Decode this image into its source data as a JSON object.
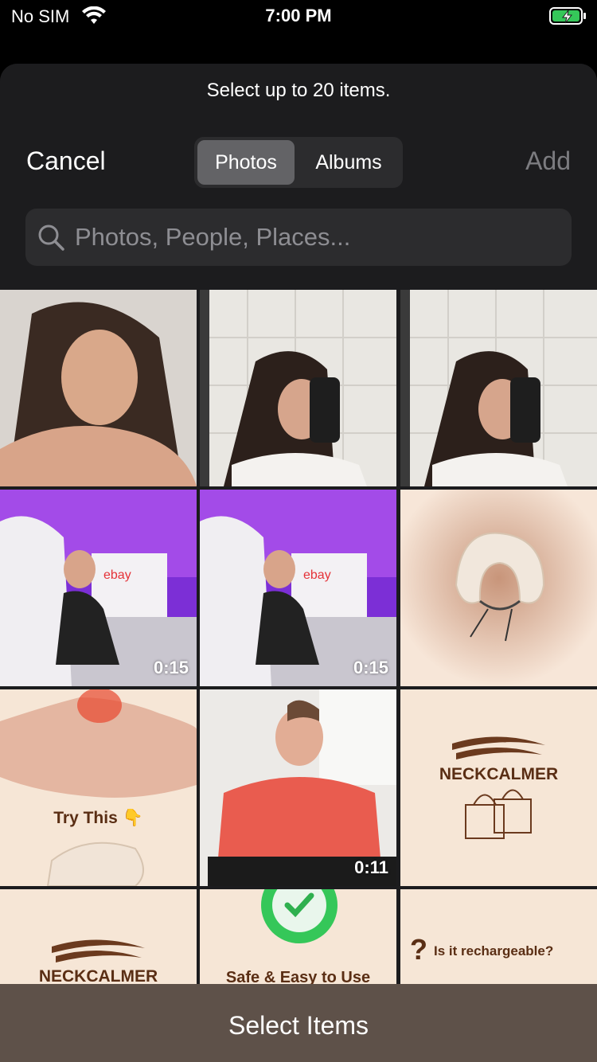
{
  "status_bar": {
    "carrier": "No SIM",
    "time": "7:00 PM",
    "battery_color": "#35c759"
  },
  "header": {
    "hint": "Select up to 20 items.",
    "cancel_label": "Cancel",
    "add_label": "Add",
    "segments": [
      "Photos",
      "Albums"
    ],
    "selected_segment": "Photos"
  },
  "search": {
    "placeholder": "Photos, People, Places..."
  },
  "grid": {
    "items": [
      {
        "type": "photo",
        "label": "selfie-woman"
      },
      {
        "type": "photo",
        "label": "mirror-selfie"
      },
      {
        "type": "photo",
        "label": "mirror-selfie"
      },
      {
        "type": "video",
        "duration": "0:15"
      },
      {
        "type": "video",
        "duration": "0:15"
      },
      {
        "type": "photo",
        "label": "neck-pillow"
      },
      {
        "type": "photo",
        "caption": "Try This 👇"
      },
      {
        "type": "video",
        "duration": "0:11"
      },
      {
        "type": "photo",
        "brand": "NECKCALMER"
      },
      {
        "type": "photo",
        "brand": "NECKCALMER"
      },
      {
        "type": "photo",
        "caption": "Safe & Easy to Use"
      },
      {
        "type": "photo",
        "caption": "Is it rechargeable?"
      }
    ]
  },
  "bottom": {
    "select_items_label": "Select Items"
  }
}
